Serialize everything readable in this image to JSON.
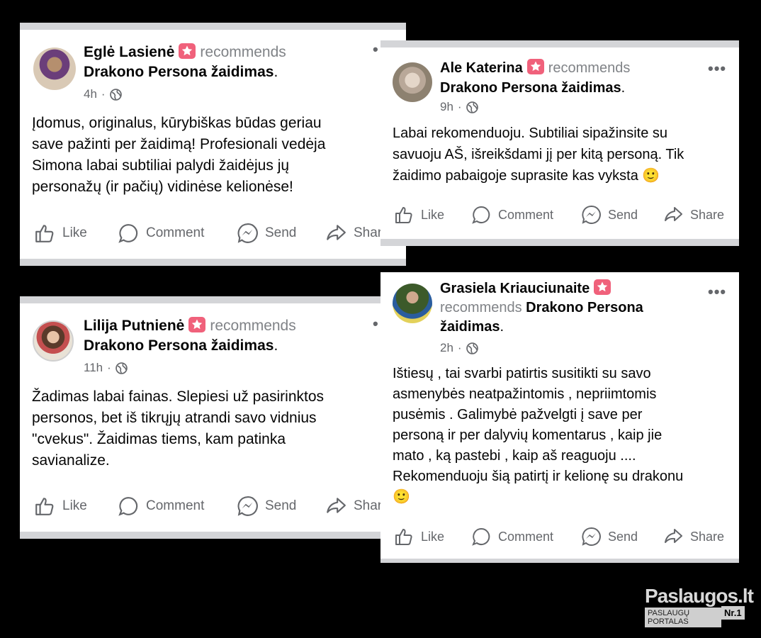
{
  "posts": [
    {
      "author": "Eglė Lasienė",
      "recommends": "recommends",
      "page": "Drakono Persona žaidimas",
      "time": "4h",
      "text_lines": [
        "Įdomus, originalus, kūrybiškas būdas geriau",
        "save pažinti per žaidimą! Profesionali vedėja",
        "Simona labai subtiliai palydi žaidėjus jų",
        "personažų (ir pačių) vidinėse kelionėse!"
      ]
    },
    {
      "author": "Ale Katerina",
      "recommends": "recommends",
      "page": "Drakono Persona žaidimas",
      "time": "9h",
      "text_lines": [
        "Labai rekomenduoju. Subtiliai sipažinsite su",
        "savuoju AŠ, išreikšdami jį per kitą personą. Tik",
        "žaidimo pabaigoje suprasite kas vyksta 🙂"
      ]
    },
    {
      "author": "Lilija Putnienė",
      "recommends": "recommends",
      "page": "Drakono Persona žaidimas",
      "time": "11h",
      "text_lines": [
        "Žadimas labai fainas. Slepiesi už pasirinktos",
        "personos, bet iš tikrųjų atrandi savo vidnius",
        "\"cvekus\". Žaidimas tiems, kam patinka",
        "savianalize."
      ]
    },
    {
      "author": "Grasiela Kriauciunaite",
      "recommends": "recommends",
      "page": "Drakono Persona",
      "page2": "žaidimas",
      "time": "2h",
      "text_lines": [
        "Ištiesų , tai svarbi patirtis susitikti su savo",
        "asmenybės neatpažintomis , nepriimtomis",
        "pusėmis . Galimybė pažvelgti į save per",
        "personą ir per dalyvių komentarus , kaip jie",
        "mato , ką pastebi , kaip aš reaguoju ....",
        "Rekomenduoju šią patirtį ir kelionę su drakonu",
        "🙂"
      ]
    }
  ],
  "actions": {
    "like": "Like",
    "comment": "Comment",
    "send": "Send",
    "share": "Share",
    "share_cut": "Shar"
  },
  "watermark": {
    "brand": "Paslaugos.lt",
    "tagline": "PASLAUGŲ PORTALAS",
    "rank": "Nr.1"
  },
  "colors": {
    "badge": "#f0617b",
    "secondary_text": "#65676b",
    "recommends_text": "#808387"
  }
}
